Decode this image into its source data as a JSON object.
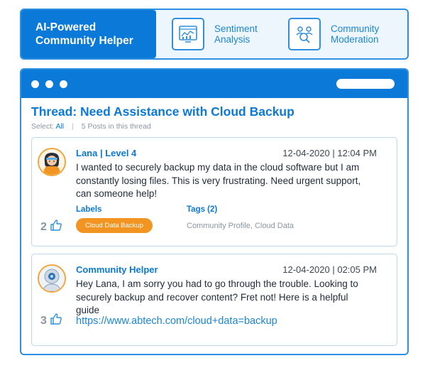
{
  "brand": {
    "line1": "AI-Powered",
    "line2": "Community Helper"
  },
  "features": [
    {
      "line1": "Sentiment",
      "line2": "Analysis",
      "icon": "analytics-chart-icon"
    },
    {
      "line1": "Community",
      "line2": "Moderation",
      "icon": "users-search-icon"
    }
  ],
  "thread": {
    "title": "Thread: Need Assistance with Cloud Backup",
    "select_prefix": "Select:",
    "select_all": "All",
    "separator": "|",
    "post_count": "5 Posts in this thread"
  },
  "posts": [
    {
      "author": "Lana | Level 4",
      "timestamp": "12-04-2020  |  12:04 PM",
      "body": "I wanted to securely backup my data in the cloud software but I am constantly losing files. This is very frustrating. Need urgent support, can someone help!",
      "likes": "2",
      "labels_heading": "Labels",
      "label": "Cloud Data Backup",
      "tags_heading": "Tags (2)",
      "tags": "Community Profile, Cloud Data",
      "avatar_icon": "user-avatar-icon"
    },
    {
      "author": "Community Helper",
      "timestamp": "12-04-2020  |  02:05 PM",
      "body": "Hey Lana, I am sorry you had to go through the trouble. Looking to securely backup and recover content? Fret not! Here is a helpful guide",
      "likes": "3",
      "link": "https://www.abtech.com/cloud+data=backup",
      "avatar_icon": "robot-avatar-icon"
    }
  ],
  "colors": {
    "primary": "#0a79d7",
    "border": "#2f8fe0",
    "label_orange": "#f29421",
    "muted": "#8a96a3"
  }
}
